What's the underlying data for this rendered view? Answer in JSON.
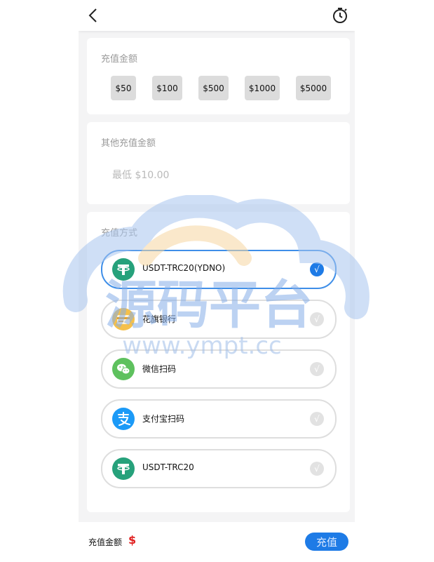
{
  "header": {
    "back_icon": "chevron-left-icon",
    "history_icon": "timer-icon"
  },
  "amount_section": {
    "title": "充值金额",
    "options": [
      "$50",
      "$100",
      "$500",
      "$1000",
      "$5000"
    ]
  },
  "other_amount_section": {
    "title": "其他充值金额",
    "placeholder": "最低 $10.00",
    "value": ""
  },
  "method_section": {
    "title": "充值方式",
    "methods": [
      {
        "label": "USDT-TRC20(YDNO)",
        "icon": "tether-icon",
        "selected": true
      },
      {
        "label": "花旗银行",
        "icon": "bank-card-icon",
        "selected": false
      },
      {
        "label": "微信扫码",
        "icon": "wechat-icon",
        "selected": false
      },
      {
        "label": "支付宝扫码",
        "icon": "alipay-icon",
        "selected": false
      },
      {
        "label": "USDT-TRC20",
        "icon": "tether-icon",
        "selected": false
      }
    ],
    "check_mark": "√"
  },
  "watermark": {
    "title": "源码平台",
    "url": "www.ympt.cc"
  },
  "footer": {
    "label": "充值金额",
    "currency": "$",
    "submit_label": "充值"
  },
  "colors": {
    "accent": "#1e7be6",
    "selected_border": "#3e8ee8",
    "currency_red": "#e02020",
    "tether_green": "#26a17b",
    "wechat_green": "#5ec15e",
    "alipay_blue": "#1b9af7",
    "bank_yellow": "#f5c04a"
  }
}
